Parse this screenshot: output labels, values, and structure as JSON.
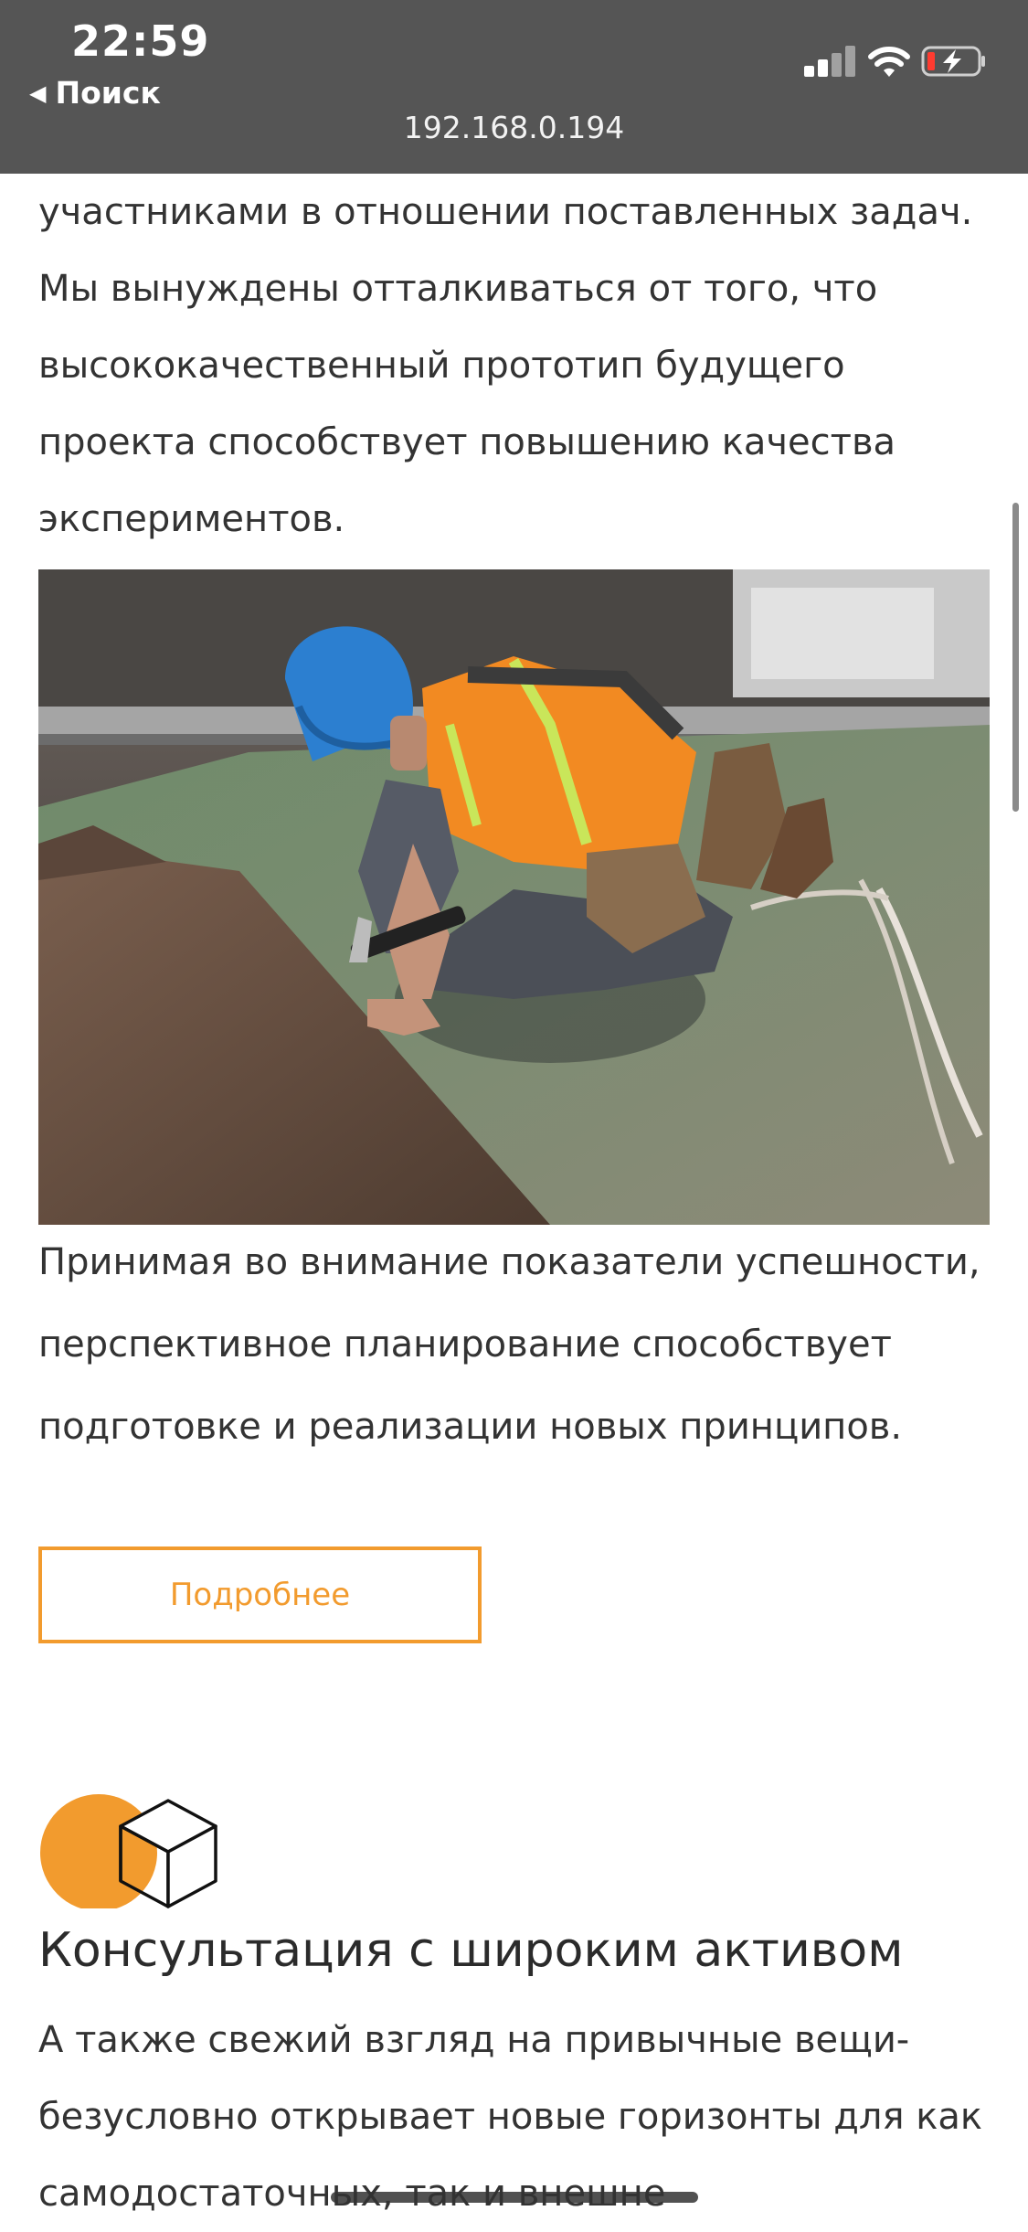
{
  "status_bar": {
    "time": "22:59",
    "back_label": "Поиск",
    "url": "192.168.0.194",
    "background": "#555555"
  },
  "article": {
    "intro_text": "участниками в отношении поставленных задач. Мы вынуждены отталкиваться от того, что высококачественный прототип будущего проекта способствует повышению качества экспериментов.",
    "image_icon": "construction-worker-photo",
    "body_text": "Принимая во внимание показатели успешности, перспективное планирование способствует подготовке и реализации новых принципов.",
    "more_button": "Подробнее"
  },
  "feature": {
    "icon": "cube-icon",
    "title": "Консультация с широким активом",
    "text": "А также свежий взгляд на привычные вещи- безусловно открывает новые горизонты для как самодостаточных, так и внешне"
  },
  "colors": {
    "accent": "#f29b2e",
    "text": "#333333"
  }
}
